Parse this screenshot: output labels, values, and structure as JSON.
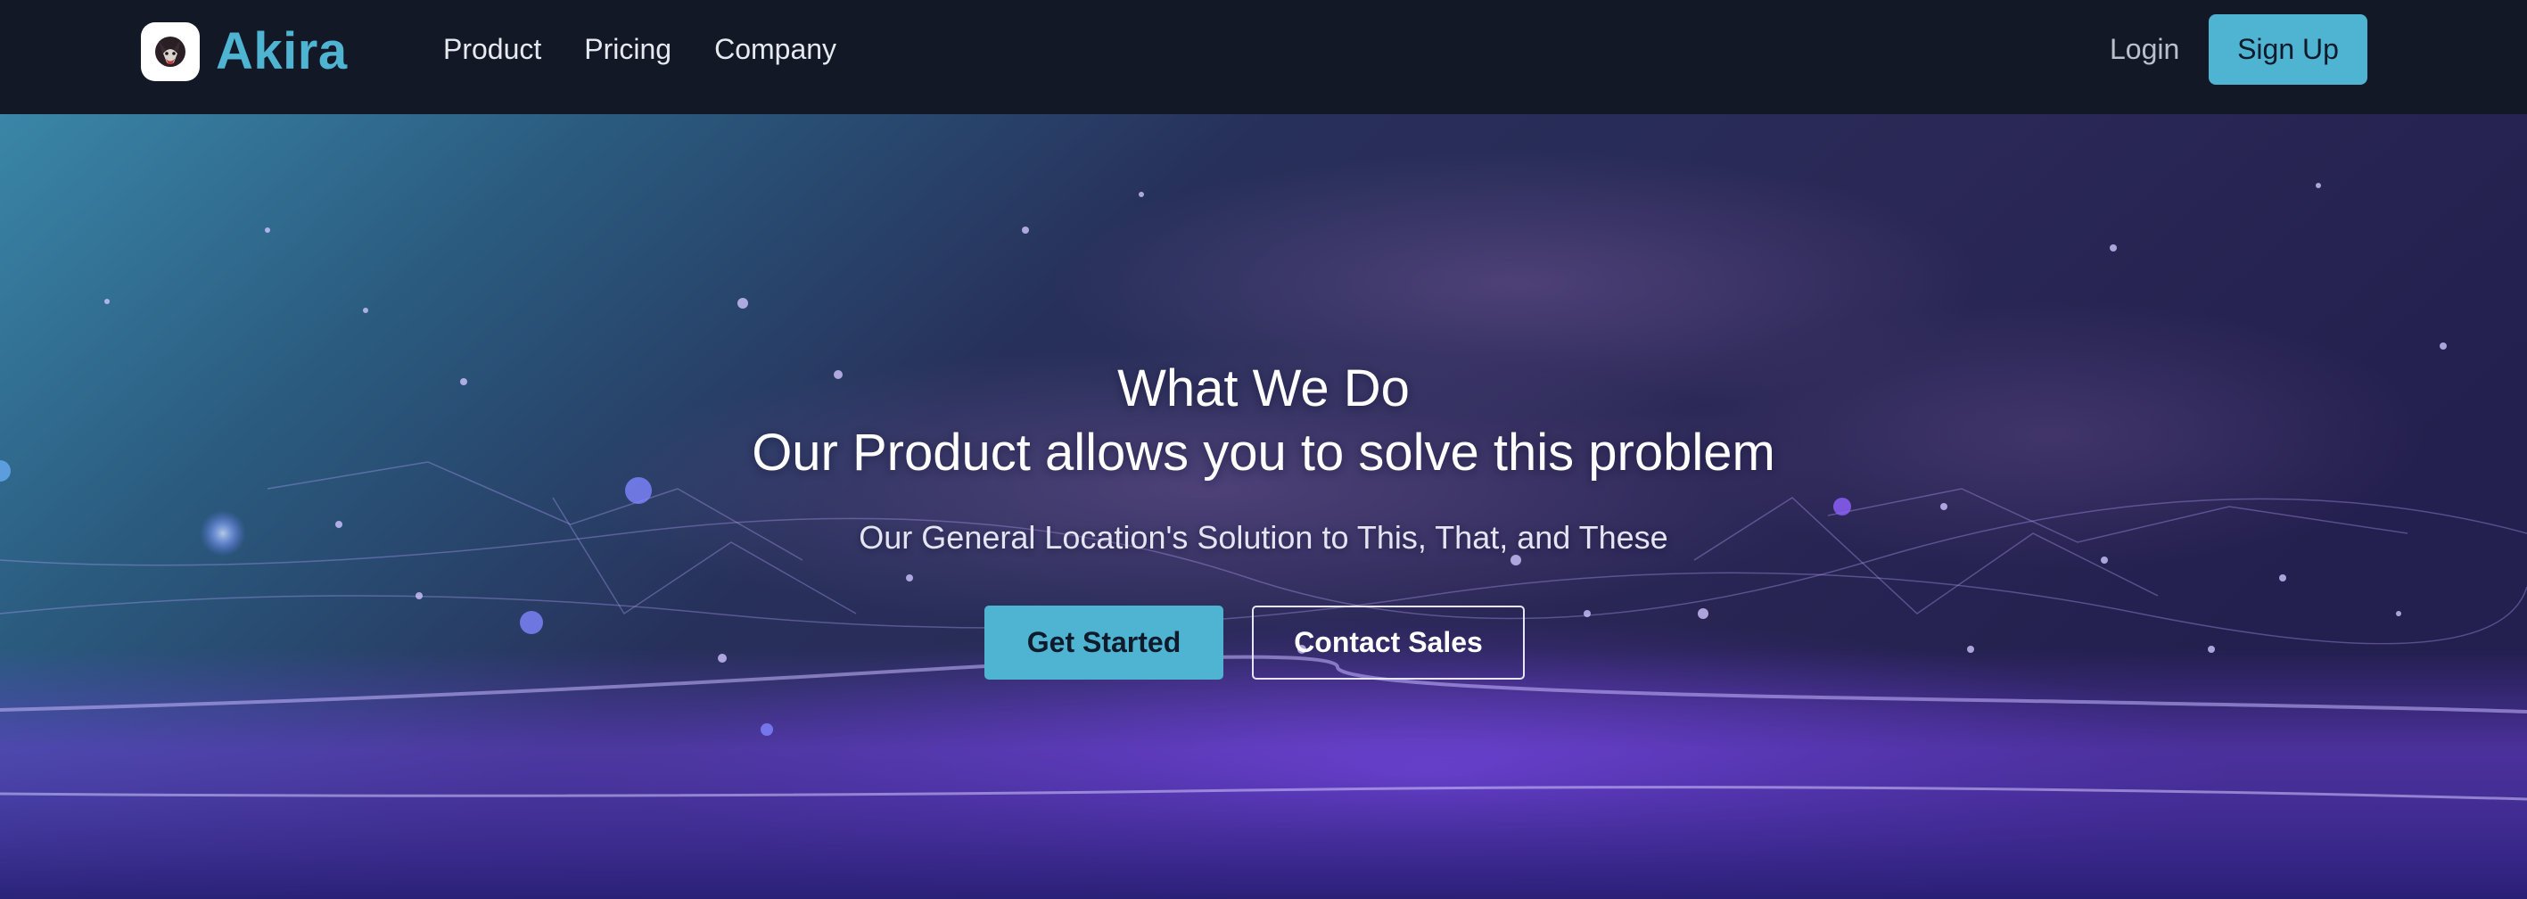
{
  "brand": {
    "name": "Akira",
    "logo_icon": "wolf-logo-icon"
  },
  "nav": {
    "links": [
      {
        "label": "Product"
      },
      {
        "label": "Pricing"
      },
      {
        "label": "Company"
      }
    ],
    "login_label": "Login",
    "signup_label": "Sign Up"
  },
  "hero": {
    "heading": "What We Do",
    "subheading": "Our Product allows you to solve this problem",
    "tagline": "Our General Location's Solution to This, That, and These",
    "primary_cta": "Get Started",
    "secondary_cta": "Contact Sales"
  },
  "colors": {
    "navbar_bg": "#121826",
    "accent": "#4fb3d2",
    "hero_purple": "#6b3fd0",
    "hero_teal": "#3f8fb0"
  }
}
